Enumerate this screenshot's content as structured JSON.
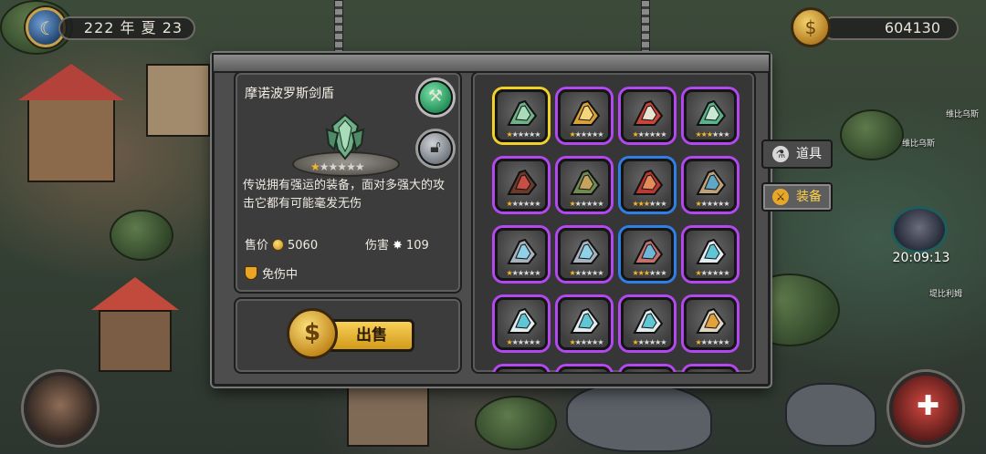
{
  "hud": {
    "date": "222 年 夏 23",
    "gold": "604130"
  },
  "item": {
    "name": "摩诺波罗斯剑盾",
    "description": "传说拥有强运的装备，面对多强大的攻击它都有可能毫发无伤",
    "star_rating": 1,
    "star_max": 6,
    "price_label": "售价",
    "price": "5060",
    "damage_label": "伤害",
    "damage": "109",
    "status": "免伤中"
  },
  "sell": {
    "label": "出售"
  },
  "tabs": {
    "items": "道具",
    "equipment": "装备"
  },
  "timer": "20:09:13",
  "map_labels": {
    "npc_1": "维比乌斯",
    "npc_2": "维比乌斯",
    "npc_3": "堤比利姆"
  },
  "colors": {
    "selected_border": "#f2d02a",
    "epic_border": "#b347f0",
    "rare_border": "#2f7fe6",
    "sell_button": "#e7b232",
    "star_on": "#f3b72a"
  },
  "inventory": [
    {
      "icon": "sword-shield-icon",
      "rarity": "selected",
      "stars": 1
    },
    {
      "icon": "golden-claw-icon",
      "rarity": "epic",
      "stars": 1
    },
    {
      "icon": "great-sword-icon",
      "rarity": "epic",
      "stars": 1
    },
    {
      "icon": "jade-dragon-blade-icon",
      "rarity": "epic",
      "stars": 3
    },
    {
      "icon": "dark-bow-icon",
      "rarity": "epic",
      "stars": 1
    },
    {
      "icon": "crossbow-icon",
      "rarity": "epic",
      "stars": 1
    },
    {
      "icon": "red-bow-icon",
      "rarity": "rare",
      "stars": 3
    },
    {
      "icon": "beast-mask-icon",
      "rarity": "epic",
      "stars": 1
    },
    {
      "icon": "crystal-mask-icon",
      "rarity": "epic",
      "stars": 1
    },
    {
      "icon": "crystal-mask-icon",
      "rarity": "epic",
      "stars": 1
    },
    {
      "icon": "crimson-mask-icon",
      "rarity": "rare",
      "stars": 3
    },
    {
      "icon": "ice-beast-icon",
      "rarity": "epic",
      "stars": 1
    },
    {
      "icon": "ice-beast-icon",
      "rarity": "epic",
      "stars": 1
    },
    {
      "icon": "ice-beast-icon",
      "rarity": "epic",
      "stars": 1
    },
    {
      "icon": "ice-beast-icon",
      "rarity": "epic",
      "stars": 1
    },
    {
      "icon": "fire-beast-icon",
      "rarity": "epic",
      "stars": 1
    },
    {
      "icon": "unknown-icon",
      "rarity": "epic",
      "stars": 0
    },
    {
      "icon": "unknown-icon",
      "rarity": "epic",
      "stars": 0
    },
    {
      "icon": "unknown-icon",
      "rarity": "epic",
      "stars": 0
    },
    {
      "icon": "unknown-icon",
      "rarity": "epic",
      "stars": 0
    }
  ]
}
